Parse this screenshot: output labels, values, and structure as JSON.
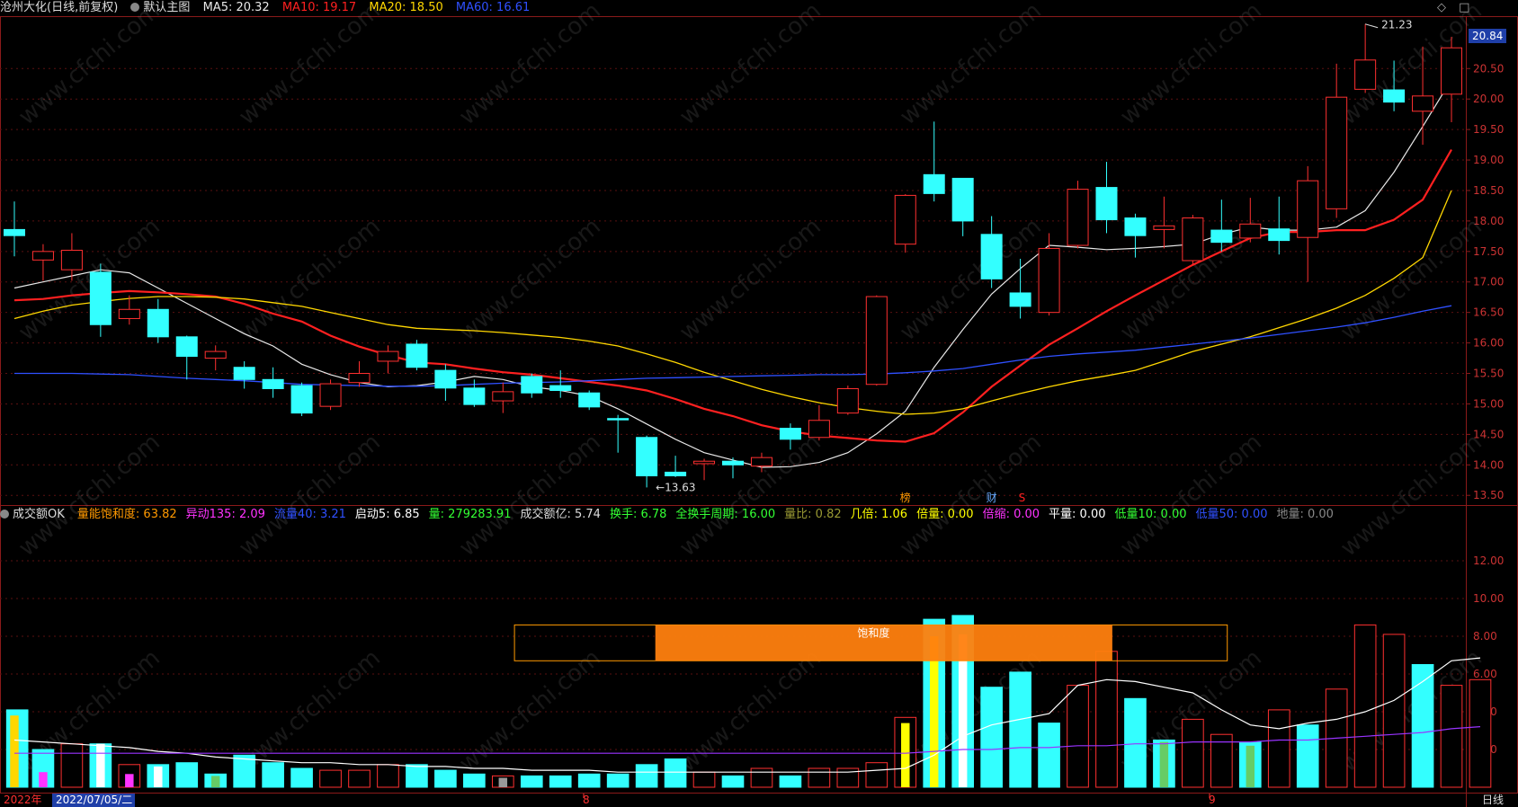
{
  "header_main": {
    "stock": "沧州大化(日线,前复权)",
    "template": "默认主图",
    "ma": [
      {
        "label": "MA5: 20.32",
        "color": "#e8e8e8"
      },
      {
        "label": "MA10: 19.17",
        "color": "#ff2020"
      },
      {
        "label": "MA20: 18.50",
        "color": "#ffd700"
      },
      {
        "label": "MA60: 16.61",
        "color": "#2f50ff"
      }
    ],
    "diamond": "◇",
    "square": "□"
  },
  "header_sub": {
    "name": "成交额OK",
    "items": [
      {
        "label": "量能饱和度: 63.82",
        "color": "#ff9900"
      },
      {
        "label": "异动135: 2.09",
        "color": "#ff33ff"
      },
      {
        "label": "流量40: 3.21",
        "color": "#2f50ff"
      },
      {
        "label": "启动5: 6.85",
        "color": "#ffffff"
      },
      {
        "label": "量: 279283.91",
        "color": "#33ff33"
      },
      {
        "label": "成交额亿: 5.74",
        "color": "#dddddd"
      },
      {
        "label": "换手: 6.78",
        "color": "#33ff33"
      },
      {
        "label": "全换手周期: 16.00",
        "color": "#33ff33"
      },
      {
        "label": "量比: 0.82",
        "color": "#999933"
      },
      {
        "label": "几倍: 1.06",
        "color": "#ffff00"
      },
      {
        "label": "倍量: 0.00",
        "color": "#ffff00"
      },
      {
        "label": "倍缩: 0.00",
        "color": "#ff33ff"
      },
      {
        "label": "平量: 0.00",
        "color": "#ffffff"
      },
      {
        "label": "低量10: 0.00",
        "color": "#33ff33"
      },
      {
        "label": "低量50: 0.00",
        "color": "#2f50ff"
      },
      {
        "label": "地量: 0.00",
        "color": "#888888"
      }
    ]
  },
  "current_price_tag": "20.84",
  "bottom_bar": {
    "year": "2022年",
    "date": "2022/07/05/二",
    "period": "日线",
    "month_marks": [
      "8",
      "9"
    ]
  },
  "annotations": {
    "high": "21.23",
    "low": "13.63",
    "saturation_label": "饱和度",
    "events": [
      {
        "text": "榜",
        "color": "#ff9900"
      },
      {
        "text": "财",
        "color": "#66aaff"
      },
      {
        "text": "S",
        "color": "#ff2020"
      }
    ]
  },
  "watermark": "www.cfchi.com",
  "chart_data": [
    {
      "type": "candlestick",
      "title": "沧州大化(日线,前复权)",
      "ylim": [
        13.4,
        21.3
      ],
      "y_ticks": [
        "20.50",
        "20.00",
        "19.50",
        "19.00",
        "18.50",
        "18.00",
        "17.50",
        "17.00",
        "16.50",
        "16.00",
        "15.50",
        "15.00",
        "14.50",
        "14.00",
        "13.50"
      ],
      "candles": [
        {
          "o": 17.86,
          "c": 17.76,
          "h": 18.32,
          "l": 17.42
        },
        {
          "o": 17.36,
          "c": 17.5,
          "h": 17.62,
          "l": 17.02
        },
        {
          "o": 17.2,
          "c": 17.52,
          "h": 17.8,
          "l": 17.02
        },
        {
          "o": 17.16,
          "c": 16.3,
          "h": 17.3,
          "l": 16.1
        },
        {
          "o": 16.4,
          "c": 16.55,
          "h": 16.78,
          "l": 16.3
        },
        {
          "o": 16.55,
          "c": 16.1,
          "h": 16.72,
          "l": 16.0
        },
        {
          "o": 16.1,
          "c": 15.78,
          "h": 16.12,
          "l": 15.4
        },
        {
          "o": 15.75,
          "c": 15.86,
          "h": 15.96,
          "l": 15.55
        },
        {
          "o": 15.6,
          "c": 15.4,
          "h": 15.7,
          "l": 15.25
        },
        {
          "o": 15.4,
          "c": 15.25,
          "h": 15.6,
          "l": 15.1
        },
        {
          "o": 15.3,
          "c": 14.85,
          "h": 15.35,
          "l": 14.8
        },
        {
          "o": 14.96,
          "c": 15.33,
          "h": 15.4,
          "l": 14.9
        },
        {
          "o": 15.35,
          "c": 15.5,
          "h": 15.7,
          "l": 15.28
        },
        {
          "o": 15.7,
          "c": 15.86,
          "h": 15.96,
          "l": 15.5
        },
        {
          "o": 15.98,
          "c": 15.6,
          "h": 16.05,
          "l": 15.55
        },
        {
          "o": 15.55,
          "c": 15.26,
          "h": 15.65,
          "l": 15.05
        },
        {
          "o": 15.26,
          "c": 14.99,
          "h": 15.4,
          "l": 14.95
        },
        {
          "o": 15.05,
          "c": 15.2,
          "h": 15.35,
          "l": 14.85
        },
        {
          "o": 15.45,
          "c": 15.18,
          "h": 15.5,
          "l": 15.1
        },
        {
          "o": 15.3,
          "c": 15.22,
          "h": 15.55,
          "l": 15.1
        },
        {
          "o": 15.18,
          "c": 14.95,
          "h": 15.22,
          "l": 14.9
        },
        {
          "o": 14.76,
          "c": 14.74,
          "h": 14.82,
          "l": 14.2
        },
        {
          "o": 14.45,
          "c": 13.82,
          "h": 14.48,
          "l": 13.63
        },
        {
          "o": 13.88,
          "c": 13.82,
          "h": 14.15,
          "l": 13.8
        },
        {
          "o": 14.02,
          "c": 14.06,
          "h": 14.1,
          "l": 13.75
        },
        {
          "o": 14.06,
          "c": 14.0,
          "h": 14.12,
          "l": 13.78
        },
        {
          "o": 13.98,
          "c": 14.12,
          "h": 14.2,
          "l": 13.88
        },
        {
          "o": 14.6,
          "c": 14.42,
          "h": 14.68,
          "l": 14.25
        },
        {
          "o": 14.45,
          "c": 14.73,
          "h": 14.98,
          "l": 14.4
        },
        {
          "o": 14.85,
          "c": 15.25,
          "h": 15.3,
          "l": 14.82
        },
        {
          "o": 15.32,
          "c": 16.76,
          "h": 16.78,
          "l": 15.3
        },
        {
          "o": 17.62,
          "c": 18.42,
          "h": 18.44,
          "l": 17.48
        },
        {
          "o": 18.76,
          "c": 18.45,
          "h": 19.63,
          "l": 18.32
        },
        {
          "o": 18.7,
          "c": 18.0,
          "h": 18.7,
          "l": 17.75
        },
        {
          "o": 17.78,
          "c": 17.05,
          "h": 18.08,
          "l": 16.9
        },
        {
          "o": 16.82,
          "c": 16.6,
          "h": 17.38,
          "l": 16.4
        },
        {
          "o": 16.5,
          "c": 17.55,
          "h": 17.8,
          "l": 16.45
        },
        {
          "o": 17.6,
          "c": 18.52,
          "h": 18.66,
          "l": 17.55
        },
        {
          "o": 18.55,
          "c": 18.02,
          "h": 18.97,
          "l": 17.8
        },
        {
          "o": 18.05,
          "c": 17.76,
          "h": 18.12,
          "l": 17.4
        },
        {
          "o": 17.86,
          "c": 17.92,
          "h": 18.4,
          "l": 17.55
        },
        {
          "o": 17.35,
          "c": 18.05,
          "h": 18.1,
          "l": 17.28
        },
        {
          "o": 17.85,
          "c": 17.65,
          "h": 18.35,
          "l": 17.5
        },
        {
          "o": 17.72,
          "c": 17.95,
          "h": 18.38,
          "l": 17.65
        },
        {
          "o": 17.87,
          "c": 17.68,
          "h": 18.4,
          "l": 17.45
        },
        {
          "o": 17.73,
          "c": 18.66,
          "h": 18.9,
          "l": 17.0
        },
        {
          "o": 18.2,
          "c": 20.03,
          "h": 20.58,
          "l": 18.05
        },
        {
          "o": 20.16,
          "c": 20.64,
          "h": 21.23,
          "l": 20.1
        },
        {
          "o": 20.15,
          "c": 19.95,
          "h": 20.63,
          "l": 19.8
        },
        {
          "o": 19.8,
          "c": 20.05,
          "h": 20.86,
          "l": 19.25
        },
        {
          "o": 20.08,
          "c": 20.84,
          "h": 21.02,
          "l": 19.62
        }
      ],
      "series": [
        {
          "name": "MA5",
          "values": [
            16.9,
            17.0,
            17.1,
            17.2,
            17.15,
            16.9,
            16.65,
            16.4,
            16.15,
            15.95,
            15.65,
            15.48,
            15.35,
            15.28,
            15.3,
            15.36,
            15.45,
            15.4,
            15.28,
            15.22,
            15.13,
            14.92,
            14.67,
            14.42,
            14.2,
            14.08,
            13.96,
            13.97,
            14.04,
            14.2,
            14.51,
            14.88,
            15.6,
            16.22,
            16.8,
            17.22,
            17.6,
            17.57,
            17.53,
            17.55,
            17.58,
            17.62,
            17.78,
            17.9,
            17.85,
            17.85,
            17.9,
            18.17,
            18.8,
            19.55,
            20.32
          ]
        },
        {
          "name": "MA10",
          "values": [
            16.7,
            16.72,
            16.78,
            16.82,
            16.85,
            16.83,
            16.8,
            16.76,
            16.64,
            16.48,
            16.35,
            16.12,
            15.94,
            15.8,
            15.68,
            15.65,
            15.58,
            15.52,
            15.48,
            15.42,
            15.36,
            15.3,
            15.22,
            15.08,
            14.92,
            14.8,
            14.65,
            14.55,
            14.48,
            14.44,
            14.4,
            14.38,
            14.52,
            14.86,
            15.28,
            15.63,
            15.97,
            16.24,
            16.52,
            16.78,
            17.03,
            17.28,
            17.5,
            17.72,
            17.82,
            17.82,
            17.85,
            17.85,
            18.02,
            18.35,
            19.17
          ]
        },
        {
          "name": "MA20",
          "values": [
            16.4,
            16.52,
            16.62,
            16.68,
            16.73,
            16.76,
            16.76,
            16.75,
            16.72,
            16.66,
            16.6,
            16.5,
            16.4,
            16.3,
            16.24,
            16.22,
            16.2,
            16.17,
            16.13,
            16.09,
            16.03,
            15.95,
            15.82,
            15.68,
            15.52,
            15.38,
            15.24,
            15.12,
            15.02,
            14.94,
            14.88,
            14.83,
            14.85,
            14.92,
            15.05,
            15.17,
            15.28,
            15.38,
            15.46,
            15.55,
            15.7,
            15.86,
            15.98,
            16.1,
            16.25,
            16.4,
            16.57,
            16.78,
            17.06,
            17.4,
            18.5
          ]
        },
        {
          "name": "MA60",
          "values": [
            15.5,
            15.5,
            15.5,
            15.49,
            15.48,
            15.45,
            15.42,
            15.4,
            15.38,
            15.35,
            15.32,
            15.31,
            15.3,
            15.29,
            15.29,
            15.3,
            15.32,
            15.34,
            15.35,
            15.36,
            15.38,
            15.4,
            15.42,
            15.43,
            15.44,
            15.45,
            15.46,
            15.47,
            15.48,
            15.48,
            15.49,
            15.51,
            15.54,
            15.58,
            15.65,
            15.72,
            15.78,
            15.82,
            15.85,
            15.88,
            15.93,
            15.98,
            16.03,
            16.08,
            16.14,
            16.2,
            16.26,
            16.33,
            16.42,
            16.52,
            16.61
          ]
        }
      ]
    },
    {
      "type": "bar",
      "title": "成交额OK",
      "ylim": [
        0,
        14
      ],
      "y_ticks": [
        "12.00",
        "10.00",
        "8.00",
        "6.00",
        "4.00",
        "2.00"
      ],
      "values": [
        4.1,
        2.0,
        2.3,
        2.3,
        1.2,
        1.2,
        1.3,
        0.7,
        1.7,
        1.3,
        1.0,
        0.9,
        0.9,
        1.2,
        1.2,
        0.9,
        0.7,
        0.6,
        0.6,
        0.6,
        0.7,
        0.7,
        1.2,
        1.5,
        0.8,
        0.6,
        1.0,
        0.6,
        1.0,
        1.0,
        1.3,
        3.7,
        8.9,
        9.1,
        5.3,
        6.1,
        3.4,
        5.4,
        7.2,
        4.7,
        2.5,
        3.6,
        2.8,
        2.4,
        4.1,
        3.3,
        5.2,
        8.6,
        8.1,
        6.5,
        5.4,
        5.7
      ],
      "up": [
        false,
        false,
        true,
        false,
        true,
        false,
        false,
        false,
        false,
        false,
        false,
        true,
        true,
        true,
        false,
        false,
        false,
        true,
        false,
        false,
        false,
        false,
        false,
        false,
        true,
        false,
        true,
        false,
        true,
        true,
        true,
        true,
        false,
        false,
        false,
        false,
        false,
        true,
        true,
        false,
        false,
        true,
        true,
        false,
        true,
        false,
        true,
        true,
        true,
        false,
        true,
        true
      ],
      "series": [
        {
          "name": "启动5",
          "values": [
            2.5,
            2.4,
            2.3,
            2.2,
            2.1,
            1.9,
            1.8,
            1.6,
            1.5,
            1.4,
            1.3,
            1.3,
            1.2,
            1.2,
            1.1,
            1.1,
            1.0,
            1.0,
            0.9,
            0.9,
            0.9,
            0.8,
            0.8,
            0.8,
            0.8,
            0.8,
            0.8,
            0.8,
            0.8,
            0.8,
            0.9,
            1.0,
            1.7,
            2.7,
            3.3,
            3.6,
            3.9,
            5.4,
            5.7,
            5.6,
            5.3,
            5.0,
            4.1,
            3.3,
            3.1,
            3.4,
            3.6,
            4.0,
            4.6,
            5.6,
            6.7,
            6.85
          ]
        },
        {
          "name": "流量40",
          "values": [
            1.8,
            1.8,
            1.8,
            1.8,
            1.8,
            1.8,
            1.8,
            1.8,
            1.8,
            1.8,
            1.8,
            1.8,
            1.8,
            1.8,
            1.8,
            1.8,
            1.8,
            1.8,
            1.8,
            1.8,
            1.8,
            1.8,
            1.8,
            1.8,
            1.8,
            1.8,
            1.8,
            1.8,
            1.8,
            1.8,
            1.8,
            1.8,
            1.9,
            2.0,
            2.0,
            2.1,
            2.1,
            2.2,
            2.2,
            2.3,
            2.3,
            2.4,
            2.4,
            2.4,
            2.5,
            2.5,
            2.6,
            2.7,
            2.8,
            2.9,
            3.1,
            3.21
          ]
        }
      ]
    }
  ]
}
